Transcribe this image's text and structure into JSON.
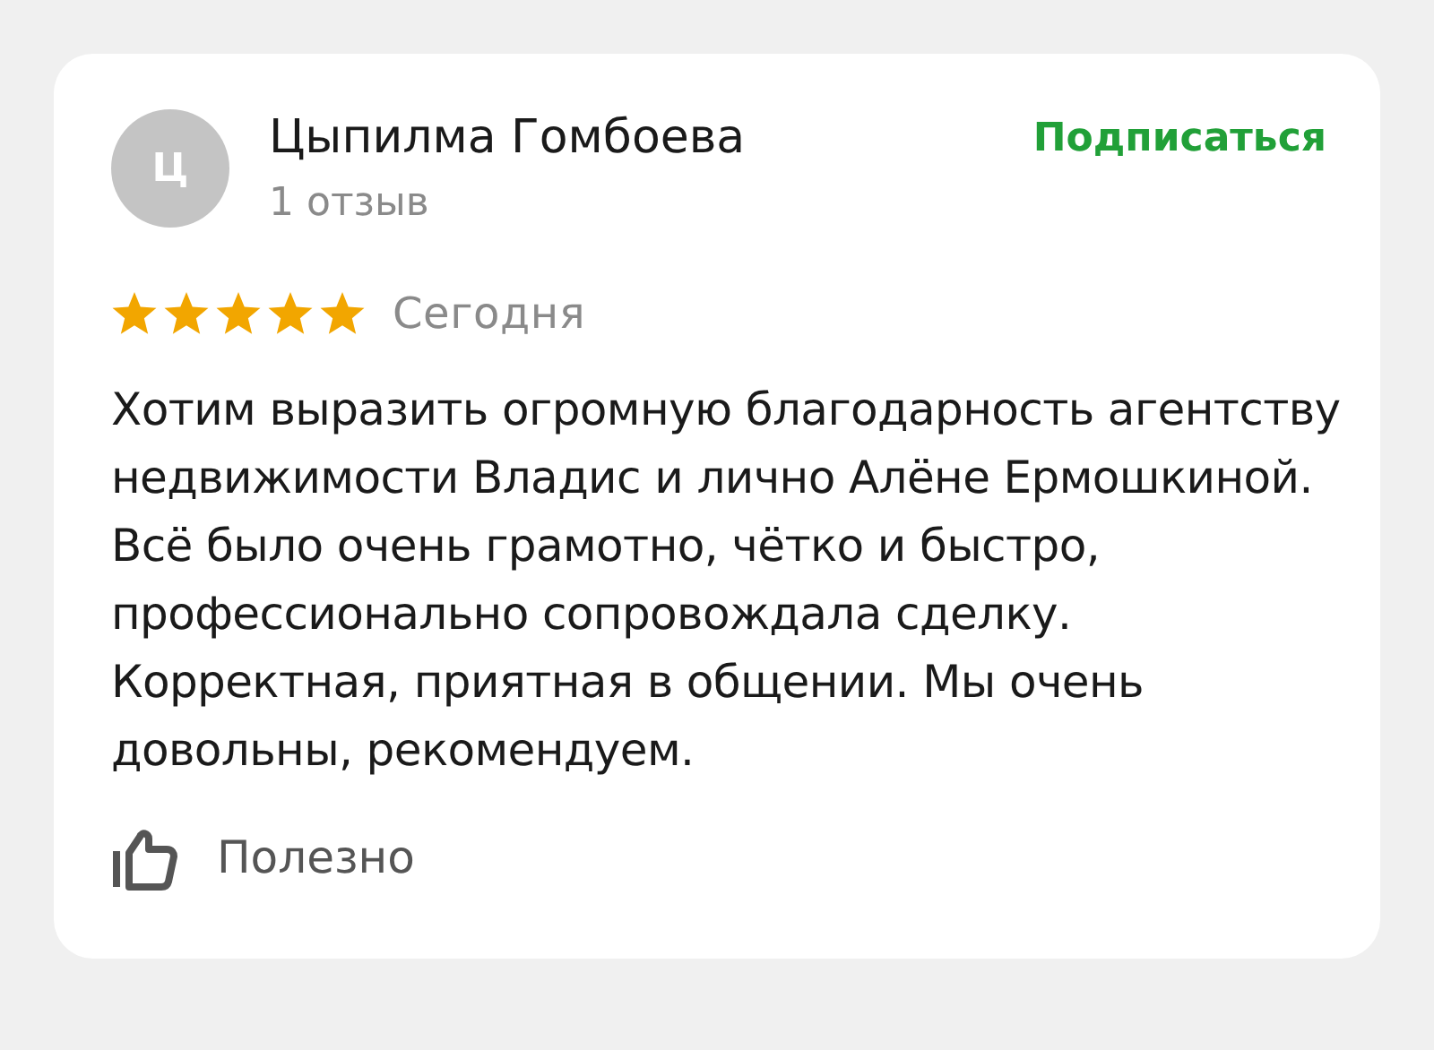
{
  "review": {
    "avatar_initial": "Ц",
    "author": "Цыпилма Гомбоева",
    "review_count": "1 отзыв",
    "subscribe": "Подписаться",
    "stars": 5,
    "date": "Сегодня",
    "text": "Хотим выразить огромную благодарность агентству недвижимости Владис и лично Алёне Ермошкиной. Всё было очень грамотно, чётко и быстро, профессионально сопровождала сделку. Корректная, приятная в общении. Мы очень довольны, рекомендуем.",
    "helpful": "Полезно"
  }
}
